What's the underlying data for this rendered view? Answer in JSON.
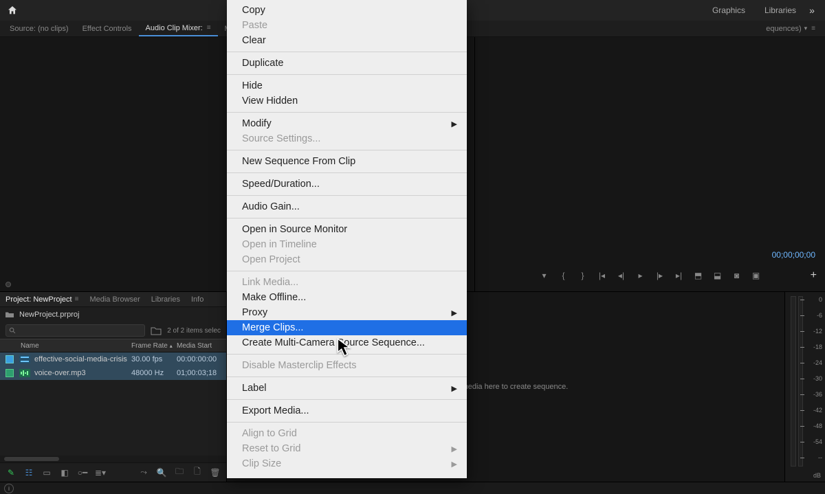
{
  "topbar": {
    "tabs": {
      "graphics": "Graphics",
      "libraries": "Libraries"
    }
  },
  "subtabs": {
    "source": "Source: (no clips)",
    "effect_controls": "Effect Controls",
    "audio_clip_mixer": "Audio Clip Mixer:",
    "metadata": "Metadata",
    "right_label": "equences)"
  },
  "program": {
    "timecode": "00;00;00;00"
  },
  "project_panel": {
    "tabs": {
      "project": "Project: NewProject",
      "media_browser": "Media Browser",
      "libraries": "Libraries",
      "info": "Info"
    },
    "project_file": "NewProject.prproj",
    "selection_text": "2 of 2 items selec",
    "columns": {
      "name": "Name",
      "frame_rate": "Frame Rate",
      "media_start": "Media Start"
    },
    "rows": [
      {
        "type": "video",
        "name": "effective-social-media-crisis",
        "frame_rate": "30.00 fps",
        "media_start": "00:00:00:00"
      },
      {
        "type": "audio",
        "name": "voice-over.mp3",
        "frame_rate": "48000 Hz",
        "media_start": "01;00:03;18"
      }
    ]
  },
  "timeline": {
    "placeholder": "Drop media here to create sequence."
  },
  "audio_meter": {
    "ticks": [
      "0",
      "-6",
      "-12",
      "-18",
      "-24",
      "-30",
      "-36",
      "-42",
      "-48",
      "-54",
      "--"
    ],
    "unit": "dB"
  },
  "context_menu": {
    "items": [
      {
        "label": "Copy",
        "disabled": false
      },
      {
        "label": "Paste",
        "disabled": true
      },
      {
        "label": "Clear",
        "disabled": false
      },
      {
        "sep": true
      },
      {
        "label": "Duplicate",
        "disabled": false
      },
      {
        "sep": true
      },
      {
        "label": "Hide",
        "disabled": false
      },
      {
        "label": "View Hidden",
        "disabled": false
      },
      {
        "sep": true
      },
      {
        "label": "Modify",
        "disabled": false,
        "submenu": true
      },
      {
        "label": "Source Settings...",
        "disabled": true
      },
      {
        "sep": true
      },
      {
        "label": "New Sequence From Clip",
        "disabled": false
      },
      {
        "sep": true
      },
      {
        "label": "Speed/Duration...",
        "disabled": false
      },
      {
        "sep": true
      },
      {
        "label": "Audio Gain...",
        "disabled": false
      },
      {
        "sep": true
      },
      {
        "label": "Open in Source Monitor",
        "disabled": false
      },
      {
        "label": "Open in Timeline",
        "disabled": true
      },
      {
        "label": "Open Project",
        "disabled": true
      },
      {
        "sep": true
      },
      {
        "label": "Link Media...",
        "disabled": true
      },
      {
        "label": "Make Offline...",
        "disabled": false
      },
      {
        "label": "Proxy",
        "disabled": false,
        "submenu": true
      },
      {
        "label": "Merge Clips...",
        "disabled": false,
        "highlight": true
      },
      {
        "label": "Create Multi-Camera Source Sequence...",
        "disabled": false
      },
      {
        "sep": true
      },
      {
        "label": "Disable Masterclip Effects",
        "disabled": true
      },
      {
        "sep": true
      },
      {
        "label": "Label",
        "disabled": false,
        "submenu": true
      },
      {
        "sep": true
      },
      {
        "label": "Export Media...",
        "disabled": false
      },
      {
        "sep": true
      },
      {
        "label": "Align to Grid",
        "disabled": true
      },
      {
        "label": "Reset to Grid",
        "disabled": true,
        "submenu": true
      },
      {
        "label": "Clip Size",
        "disabled": true,
        "submenu": true
      }
    ]
  }
}
